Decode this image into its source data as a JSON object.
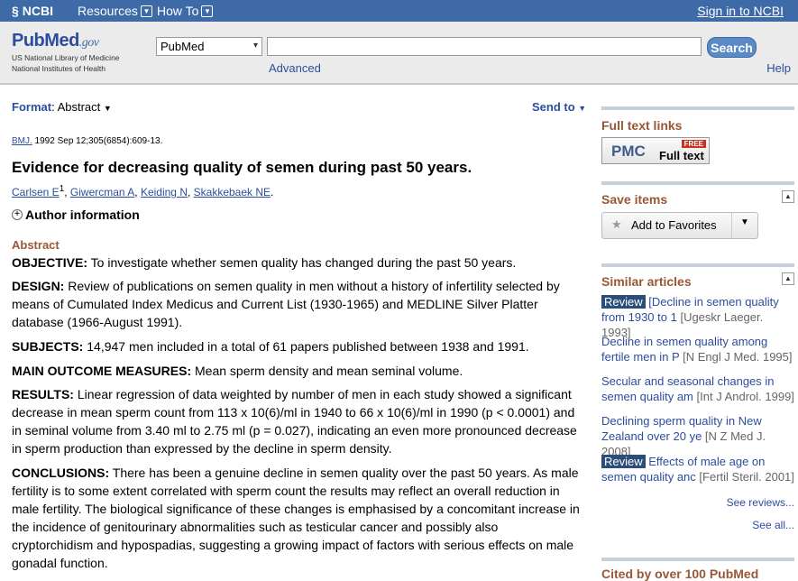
{
  "topbar": {
    "ncbi": "NCBI",
    "resources": "Resources",
    "howto": "How To",
    "signin": "Sign in to NCBI"
  },
  "search": {
    "logo_pub": "Pub",
    "logo_med": "Med",
    "logo_gov": ".gov",
    "logo_sub1": "US National Library of Medicine",
    "logo_sub2": "National Institutes of Health",
    "database": "PubMed",
    "query": "",
    "button": "Search",
    "advanced": "Advanced",
    "help": "Help"
  },
  "main": {
    "format_label": "Format",
    "format_value": "Abstract",
    "send_to": "Send to",
    "journal": "BMJ.",
    "citation": " 1992 Sep 12;305(6854):609-13.",
    "title": "Evidence for decreasing quality of semen during past 50 years.",
    "authors": [
      "Carlsen E",
      "Giwercman A",
      "Keiding N",
      "Skakkebaek NE"
    ],
    "author_sup": "1",
    "author_info": "Author information",
    "abstract_heading": "Abstract",
    "sections": [
      {
        "label": "OBJECTIVE:",
        "text": " To investigate whether semen quality has changed during the past 50 years."
      },
      {
        "label": "DESIGN:",
        "text": " Review of publications on semen quality in men without a history of infertility selected by means of Cumulated Index Medicus and Current List (1930-1965) and MEDLINE Silver Platter database (1966-August 1991)."
      },
      {
        "label": "SUBJECTS:",
        "text": " 14,947 men included in a total of 61 papers published between 1938 and 1991."
      },
      {
        "label": "MAIN OUTCOME MEASURES:",
        "text": " Mean sperm density and mean seminal volume."
      },
      {
        "label": "RESULTS:",
        "text": " Linear regression of data weighted by number of men in each study showed a significant decrease in mean sperm count from 113 x 10(6)/ml in 1940 to 66 x 10(6)/ml in 1990 (p < 0.0001) and in seminal volume from 3.40 ml to 2.75 ml (p = 0.027), indicating an even more pronounced decrease in sperm production than expressed by the decline in sperm density."
      },
      {
        "label": "CONCLUSIONS:",
        "text": " There has been a genuine decline in semen quality over the past 50 years. As male fertility is to some extent correlated with sperm count the results may reflect an overall reduction in male fertility. The biological significance of these changes is emphasised by a concomitant increase in the incidence of genitourinary abnormalities such as testicular cancer and possibly also cryptorchidism and hypospadias, suggesting a growing impact of factors with serious effects on male gonadal function."
      }
    ]
  },
  "sidebar": {
    "fulltext_title": "Full text links",
    "pmc_logo": "PMC",
    "pmc_free": "FREE",
    "pmc_fulltext": "Full text",
    "save_title": "Save items",
    "add_favorites": "Add to Favorites",
    "similar_title": "Similar articles",
    "similar": [
      {
        "tag": "Review",
        "title": "[Decline in semen quality from 1930 to 1",
        "source": "[Ugeskr Laeger. 1993]"
      },
      {
        "tag": "",
        "title": "Decline in semen quality among fertile men in P",
        "source": "[N Engl J Med. 1995]"
      },
      {
        "tag": "",
        "title": "Secular and seasonal changes in semen quality am",
        "source": "[Int J Androl. 1999]"
      },
      {
        "tag": "",
        "title": "Declining sperm quality in New Zealand over 20 ye",
        "source": "[N Z Med J. 2008]"
      },
      {
        "tag": "Review",
        "title": "Effects of male age on semen quality anc",
        "source": "[Fertil Steril. 2001]"
      }
    ],
    "see_reviews": "See reviews...",
    "see_all": "See all...",
    "cited_title": "Cited by over 100 PubMed"
  }
}
